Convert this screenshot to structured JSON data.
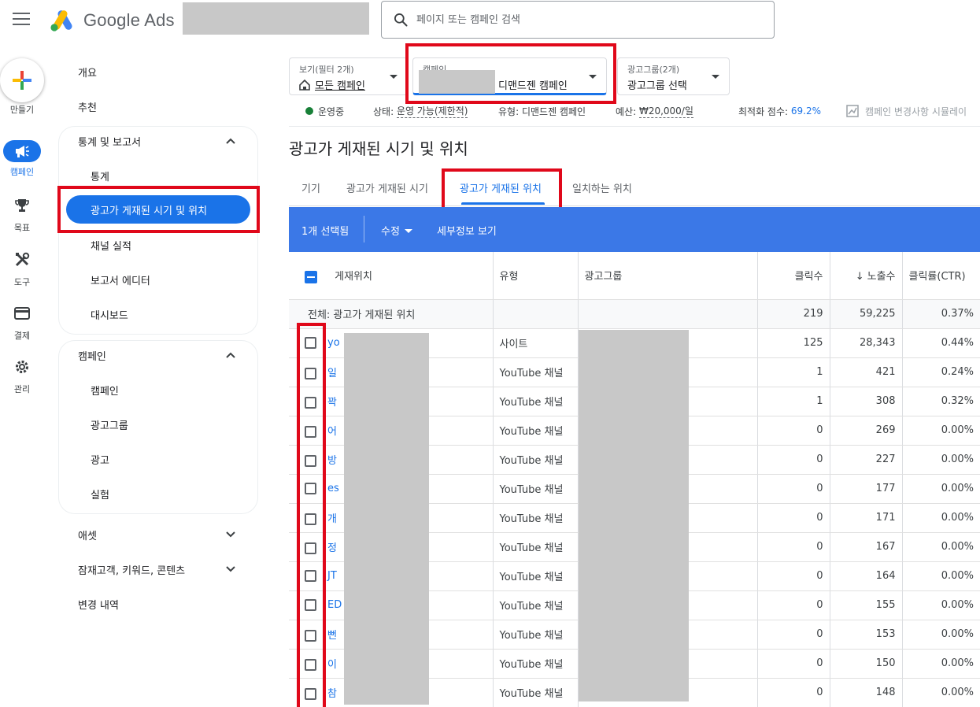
{
  "app": {
    "name": "Google Ads",
    "logo_colors": {
      "blue": "#4285F4",
      "yellow": "#FBBC04",
      "green": "#34A853"
    }
  },
  "search": {
    "placeholder": "페이지 또는 캠페인 검색"
  },
  "rail": {
    "create_label": "만들기",
    "items": [
      {
        "label": "캠페인",
        "icon": "campaign-megaphone-icon",
        "active": true
      },
      {
        "label": "목표",
        "icon": "trophy-icon"
      },
      {
        "label": "도구",
        "icon": "tools-icon"
      },
      {
        "label": "결제",
        "icon": "credit-card-icon"
      },
      {
        "label": "관리",
        "icon": "gear-icon"
      }
    ]
  },
  "nav": {
    "overview": "개요",
    "recommendations": "추천",
    "stats_reports": {
      "title": "통계 및 보고서",
      "items": [
        "통계",
        "광고가 게재된 시기 및 위치",
        "채널 실적",
        "보고서 에디터",
        "대시보드"
      ]
    },
    "campaigns": {
      "title": "캠페인",
      "items": [
        "캠페인",
        "광고그룹",
        "광고",
        "실험"
      ]
    },
    "assets": "애셋",
    "audiences": "잠재고객, 키워드, 콘텐츠",
    "change_history": "변경 내역"
  },
  "filters": {
    "view": {
      "label": "보기(필터 2개)",
      "value": "모든 캠페인"
    },
    "campaign": {
      "label": "캠페인",
      "value": "디맨드젠 캠페인"
    },
    "adgroup": {
      "label": "광고그룹(2개)",
      "value": "광고그룹 선택"
    }
  },
  "status": {
    "running": "운영중",
    "state_label": "상태:",
    "state_value": "운영 가능(제한적)",
    "type_label": "유형:",
    "type_value": "디맨드젠 캠페인",
    "budget_label": "예산:",
    "budget_value": "₩20,000/일",
    "score_label": "최적화 점수:",
    "score_value": "69.2%",
    "simulator": "캠페인 변경사항 시뮬레이"
  },
  "page_title": "광고가 게재된 시기 및 위치",
  "tabs": [
    "기기",
    "광고가 게재된 시기",
    "광고가 게재된 위치",
    "일치하는 위치"
  ],
  "action_bar": {
    "selected": "1개 선택됨",
    "edit": "수정",
    "details": "세부정보 보기"
  },
  "table": {
    "headers": {
      "placement": "게재위치",
      "type": "유형",
      "adgroup": "광고그룹",
      "clicks": "클릭수",
      "impressions": "노출수",
      "ctr": "클릭률(CTR)"
    },
    "sort_arrow": "↓",
    "total": {
      "label": "전체: 광고가 게재된 위치",
      "clicks": "219",
      "impressions": "59,225",
      "ctr": "0.37%"
    },
    "rows": [
      {
        "placement": "yo",
        "type": "사이트",
        "clicks": "125",
        "impressions": "28,343",
        "ctr": "0.44%"
      },
      {
        "placement": "일",
        "type": "YouTube 채널",
        "clicks": "1",
        "impressions": "421",
        "ctr": "0.24%"
      },
      {
        "placement": "꽉",
        "type": "YouTube 채널",
        "clicks": "1",
        "impressions": "308",
        "ctr": "0.32%"
      },
      {
        "placement": "어",
        "type": "YouTube 채널",
        "clicks": "0",
        "impressions": "269",
        "ctr": "0.00%"
      },
      {
        "placement": "방",
        "type": "YouTube 채널",
        "clicks": "0",
        "impressions": "227",
        "ctr": "0.00%"
      },
      {
        "placement": "es",
        "type": "YouTube 채널",
        "clicks": "0",
        "impressions": "177",
        "ctr": "0.00%"
      },
      {
        "placement": "개",
        "type": "YouTube 채널",
        "clicks": "0",
        "impressions": "171",
        "ctr": "0.00%"
      },
      {
        "placement": "정",
        "type": "YouTube 채널",
        "clicks": "0",
        "impressions": "167",
        "ctr": "0.00%"
      },
      {
        "placement": "JT",
        "type": "YouTube 채널",
        "clicks": "0",
        "impressions": "164",
        "ctr": "0.00%"
      },
      {
        "placement": "ED",
        "type": "YouTube 채널",
        "clicks": "0",
        "impressions": "155",
        "ctr": "0.00%"
      },
      {
        "placement": "뻔",
        "type": "YouTube 채널",
        "clicks": "0",
        "impressions": "153",
        "ctr": "0.00%"
      },
      {
        "placement": "이",
        "type": "YouTube 채널",
        "clicks": "0",
        "impressions": "150",
        "ctr": "0.00%"
      },
      {
        "placement": "참",
        "type": "YouTube 채널",
        "clicks": "0",
        "impressions": "148",
        "ctr": "0.00%"
      }
    ]
  },
  "colors": {
    "primary": "#1a73e8",
    "action_bar": "#3b78e7",
    "highlight": "#e0081a",
    "running": "#188038"
  }
}
